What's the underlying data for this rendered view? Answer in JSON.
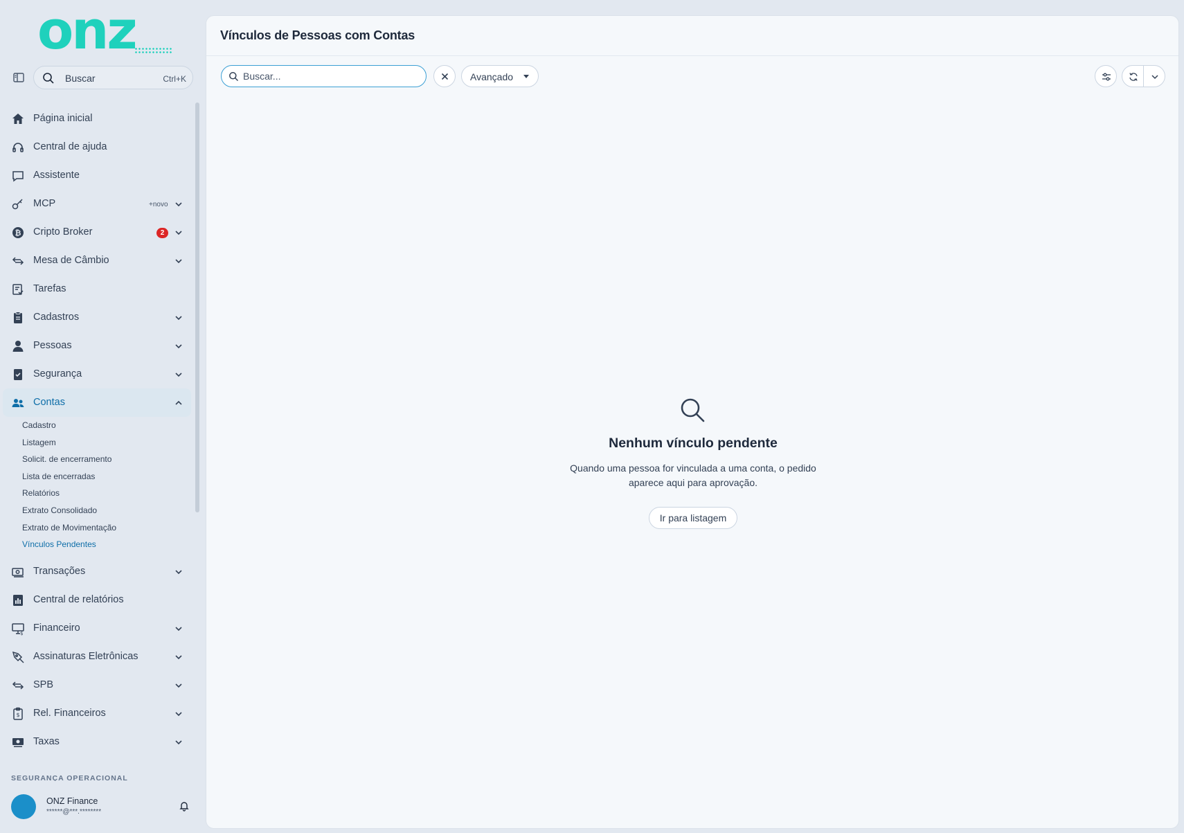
{
  "app": {
    "logo_text": "onz"
  },
  "sidebar": {
    "search_label": "Buscar",
    "search_shortcut": "Ctrl+K",
    "items": [
      {
        "label": "Página inicial",
        "icon": "home-icon"
      },
      {
        "label": "Central de ajuda",
        "icon": "headset-icon"
      },
      {
        "label": "Assistente",
        "icon": "chat-icon"
      },
      {
        "label": "MCP",
        "icon": "key-icon",
        "tag": "+novo",
        "expandable": true
      },
      {
        "label": "Cripto Broker",
        "icon": "bitcoin-icon",
        "badge": "2",
        "expandable": true
      },
      {
        "label": "Mesa de Câmbio",
        "icon": "exchange-icon",
        "expandable": true
      },
      {
        "label": "Tarefas",
        "icon": "tasks-icon"
      },
      {
        "label": "Cadastros",
        "icon": "clipboard-icon",
        "expandable": true
      },
      {
        "label": "Pessoas",
        "icon": "person-icon",
        "expandable": true
      },
      {
        "label": "Segurança",
        "icon": "shield-check-icon",
        "expandable": true
      },
      {
        "label": "Contas",
        "icon": "accounts-icon",
        "expandable": true,
        "expanded": true,
        "active": true
      },
      {
        "label": "Transações",
        "icon": "money-icon",
        "expandable": true
      },
      {
        "label": "Central de relatórios",
        "icon": "report-icon"
      },
      {
        "label": "Financeiro",
        "icon": "finance-icon",
        "expandable": true
      },
      {
        "label": "Assinaturas Eletrônicas",
        "icon": "signature-icon",
        "expandable": true
      },
      {
        "label": "SPB",
        "icon": "transfer-icon",
        "expandable": true
      },
      {
        "label": "Rel. Financeiros",
        "icon": "clipboard-money-icon",
        "expandable": true
      },
      {
        "label": "Taxas",
        "icon": "cash-icon",
        "expandable": true
      }
    ],
    "contas_sub": [
      "Cadastro",
      "Listagem",
      "Solicit. de encerramento",
      "Lista de encerradas",
      "Relatórios",
      "Extrato Consolidado",
      "Extrato de Movimentação",
      "Vínculos Pendentes"
    ],
    "contas_sub_current": "Vínculos Pendentes",
    "section_label": "SEGURANÇA OPERACIONAL",
    "user": {
      "name": "ONZ Finance",
      "email": "******@***.********"
    }
  },
  "main": {
    "title": "Vínculos de Pessoas com Contas",
    "search_placeholder": "Buscar...",
    "advanced_label": "Avançado",
    "empty": {
      "title": "Nenhum vínculo pendente",
      "description": "Quando uma pessoa for vinculada a uma conta, o pedido aparece aqui para aprovação.",
      "button": "Ir para listagem"
    }
  },
  "colors": {
    "brand": "#1fd1bc",
    "accent": "#0e6ea8",
    "badge": "#dc2626",
    "avatar": "#1b8fc9"
  }
}
